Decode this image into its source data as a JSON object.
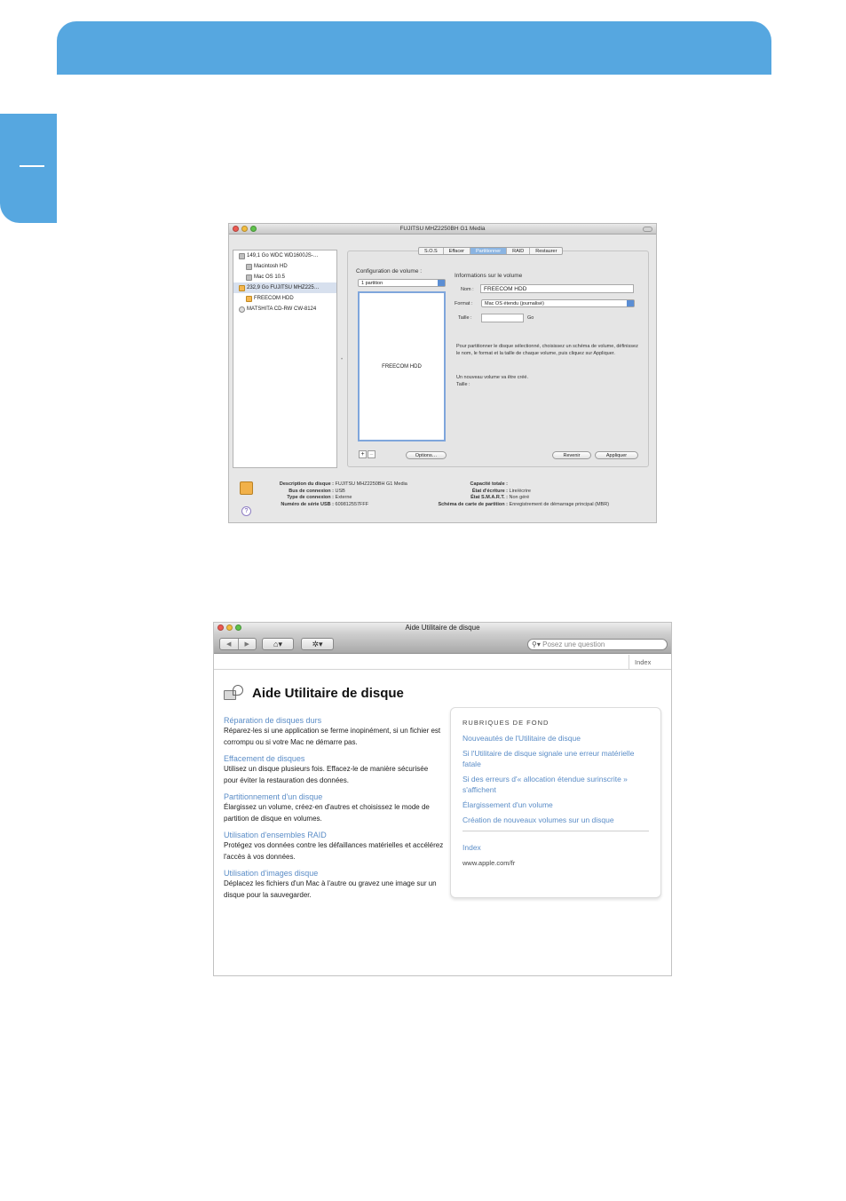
{
  "disk_utility": {
    "title": "FUJITSU MHZ2250BH G1 Media",
    "sidebar": [
      {
        "label": "149,1 Go WDC WD1600JS-…",
        "indent": false,
        "selected": false,
        "icon": "hard-disk-icon"
      },
      {
        "label": "Macintosh HD",
        "indent": true,
        "selected": false,
        "icon": "volume-icon"
      },
      {
        "label": "Mac OS 10.5",
        "indent": true,
        "selected": false,
        "icon": "volume-icon"
      },
      {
        "label": "232,9 Go FUJITSU MHZ225…",
        "indent": false,
        "selected": true,
        "icon": "external-disk-icon"
      },
      {
        "label": "FREECOM HDD",
        "indent": true,
        "selected": false,
        "icon": "external-volume-icon"
      },
      {
        "label": "MATSHITA CD-RW CW-8124",
        "indent": false,
        "selected": false,
        "icon": "cd-drive-icon"
      }
    ],
    "tabs": [
      {
        "label": "S.O.S",
        "active": false
      },
      {
        "label": "Effacer",
        "active": false
      },
      {
        "label": "Partitionner",
        "active": true
      },
      {
        "label": "RAID",
        "active": false
      },
      {
        "label": "Restaurer",
        "active": false
      }
    ],
    "config_label": "Configuration de volume :",
    "config_value": "1 partition",
    "volume_map_label": "FREECOM HDD",
    "info_label": "Informations sur le volume",
    "name_label": "Nom :",
    "name_value": "FREECOM HDD",
    "format_label": "Format :",
    "format_value": "Mac OS étendu (journalisé)",
    "size_label": "Taille :",
    "size_value": "",
    "size_unit": "Go",
    "instructions": "Pour partitionner le disque sélectionné, choisissez un schéma de volume, définissez le nom, le format et la taille de chaque volume, puis cliquez sur Appliquer.",
    "new_volume_line1": "Un nouveau volume va être créé.",
    "new_volume_line2": "Taille :",
    "plus": "+",
    "minus": "–",
    "options_btn": "Options…",
    "revert_btn": "Revenir",
    "apply_btn": "Appliquer",
    "divider_glyph": "•",
    "help_glyph": "?",
    "details_left": [
      {
        "key": "Description du disque :",
        "value": "FUJITSU MHZ2250BH G1 Media"
      },
      {
        "key": "Bus de connexion :",
        "value": "USB"
      },
      {
        "key": "Type de connexion :",
        "value": "Externe"
      },
      {
        "key": "Numéro de série USB :",
        "value": "609812557FFF"
      }
    ],
    "details_right": [
      {
        "key": "Capacité totale :",
        "value": ""
      },
      {
        "key": "État d'écriture :",
        "value": "Lire/écrire"
      },
      {
        "key": "État S.M.A.R.T. :",
        "value": "Non géré"
      },
      {
        "key": "Schéma de carte de partition :",
        "value": "Enregistrement de démarrage principal (MBR)"
      }
    ]
  },
  "help_viewer": {
    "title": "Aide Utilitaire de disque",
    "nav_back": "◀",
    "nav_forward": "▶",
    "home_glyph": "⌂▾",
    "action_glyph": "✲▾",
    "search_placeholder": "Posez une question",
    "index_tab": "Index",
    "heading": "Aide Utilitaire de disque",
    "topics": [
      {
        "title": "Réparation de disques durs",
        "desc": "Réparez-les si une application se ferme inopinément, si un fichier est corrompu ou si votre Mac ne démarre pas."
      },
      {
        "title": "Effacement de disques",
        "desc": "Utilisez un disque plusieurs fois. Effacez-le de manière sécurisée pour éviter la restauration des données."
      },
      {
        "title": "Partitionnement d'un disque",
        "desc": "Élargissez un volume, créez-en d'autres et choisissez le mode de partition de disque en volumes."
      },
      {
        "title": "Utilisation d'ensembles RAID",
        "desc": "Protégez vos données contre les défaillances matérielles et accélérez l'accès à vos données."
      },
      {
        "title": "Utilisation d'images disque",
        "desc": "Déplacez les fichiers d'un Mac à l'autre ou gravez une image sur un disque pour la sauvegarder."
      }
    ],
    "background_heading": "RUBRIQUES DE FOND",
    "background_links": [
      "Nouveautés de l'Utilitaire de disque",
      "Si l'Utilitaire de disque signale une erreur matérielle fatale",
      "Si des erreurs d'« allocation étendue surinscrite » s'affichent",
      "Élargissement d'un volume",
      "Création de nouveaux volumes sur un disque"
    ],
    "index_link": "Index",
    "website": "www.apple.com/fr"
  }
}
